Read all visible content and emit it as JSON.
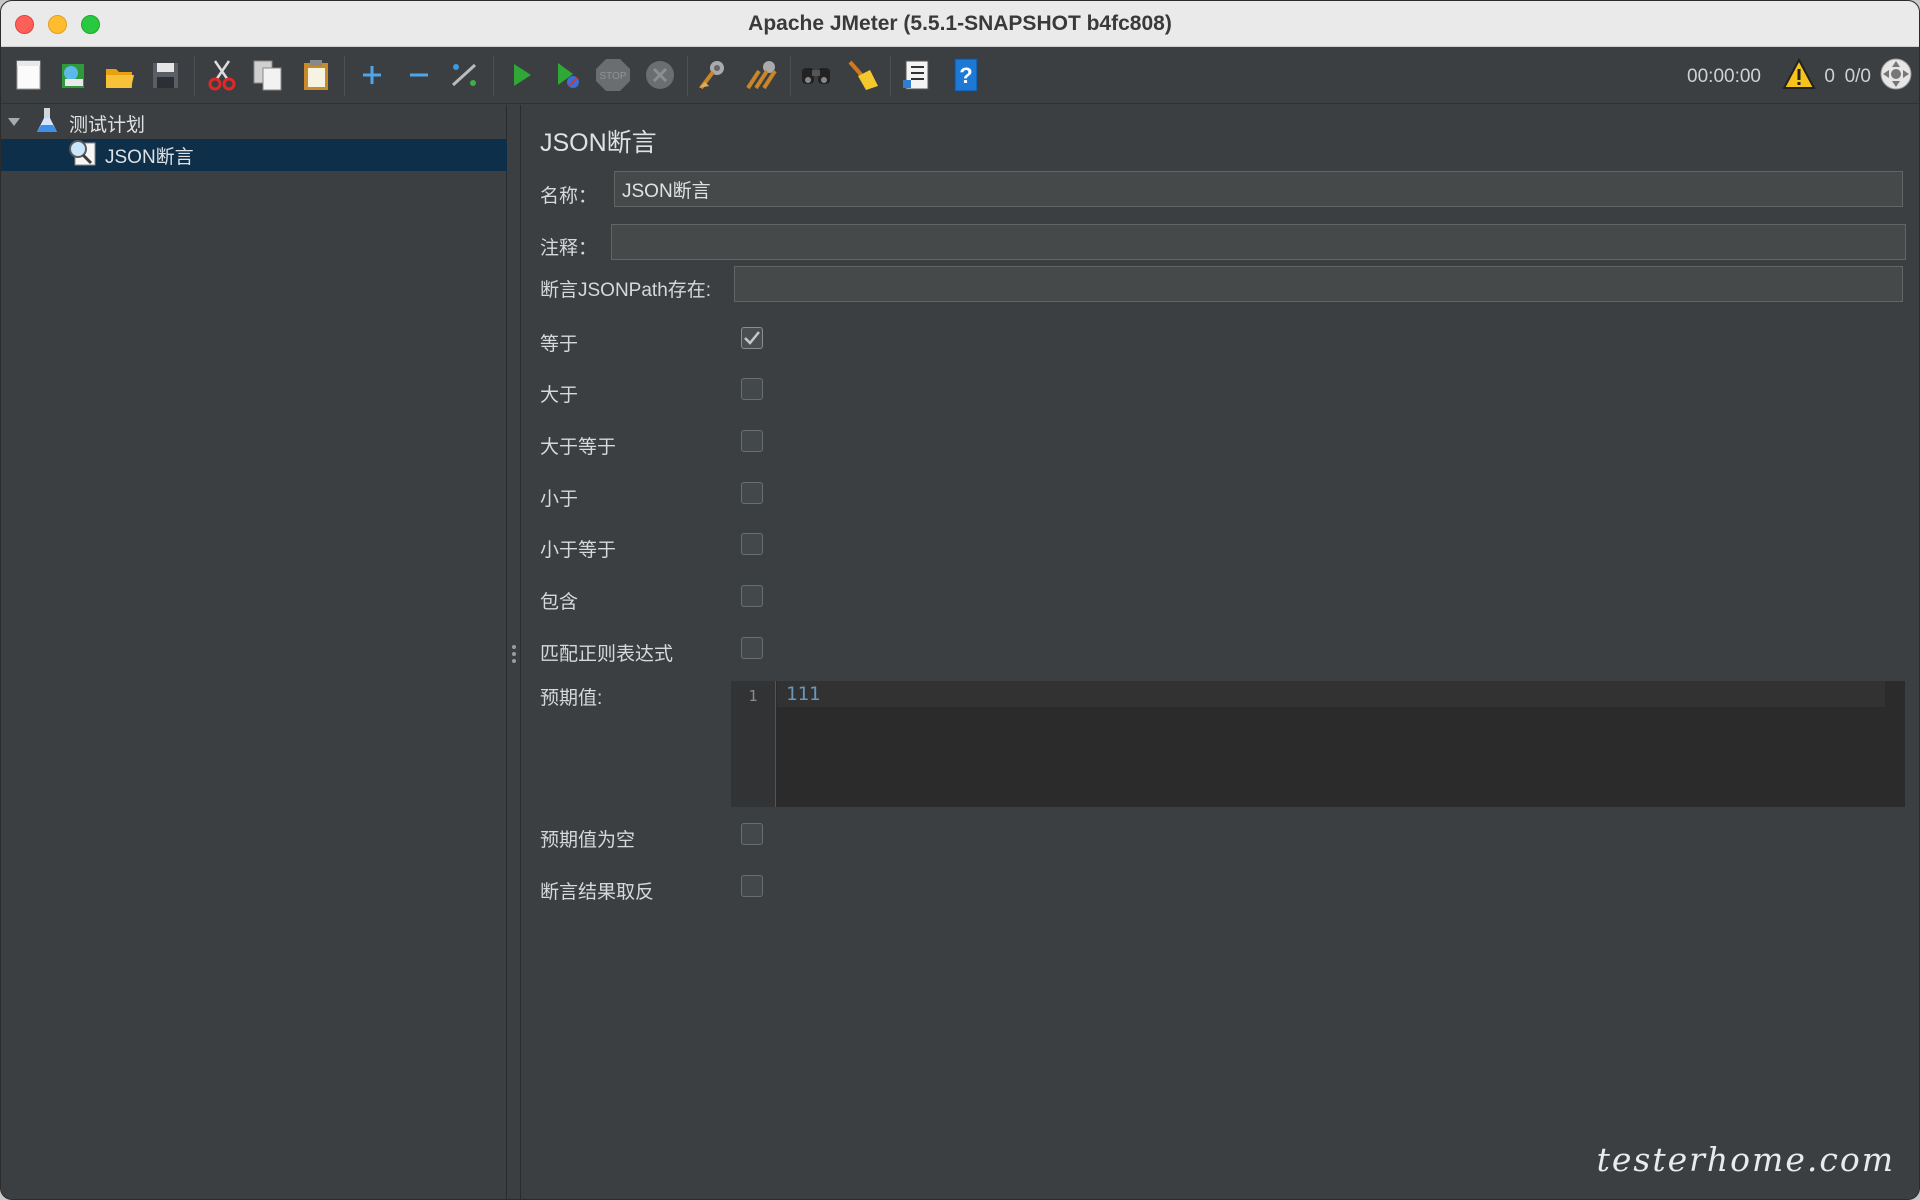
{
  "window": {
    "title": "Apache JMeter (5.5.1-SNAPSHOT b4fc808)"
  },
  "toolbar": {
    "buttons": [
      "new-icon",
      "templates-icon",
      "open-icon",
      "save-icon",
      "cut-icon",
      "copy-icon",
      "paste-icon",
      "expand-icon",
      "collapse-icon",
      "toggle-icon",
      "start-icon",
      "start-no-pauses-icon",
      "stop-icon",
      "shutdown-icon",
      "clear-icon",
      "clear-all-icon",
      "search-icon",
      "reset-search-icon",
      "function-helper-icon",
      "help-icon"
    ],
    "timer": "00:00:00",
    "error_count": "0",
    "thread_count": "0/0"
  },
  "tree": {
    "root_label": "测试计划",
    "child_label": "JSON断言"
  },
  "panel": {
    "title": "JSON断言",
    "name_label": "名称：",
    "name_value": "JSON断言",
    "comment_label": "注释：",
    "comment_value": "",
    "jsonpath_label": "断言JSONPath存在:",
    "jsonpath_value": "",
    "options": [
      {
        "label": "等于",
        "checked": true
      },
      {
        "label": "大于",
        "checked": false
      },
      {
        "label": "大于等于",
        "checked": false
      },
      {
        "label": "小于",
        "checked": false
      },
      {
        "label": "小于等于",
        "checked": false
      },
      {
        "label": "包含",
        "checked": false
      },
      {
        "label": "匹配正则表达式",
        "checked": false
      }
    ],
    "expected_label": "预期值:",
    "expected_line_number": "1",
    "expected_value": "111",
    "expect_null_label": "预期值为空",
    "expect_null_checked": false,
    "invert_label": "断言结果取反",
    "invert_checked": false
  },
  "watermark": "testerhome.com",
  "colors": {
    "selection": "#0d2f4a",
    "background": "#3c3f41",
    "code_number": "#6897bb"
  }
}
